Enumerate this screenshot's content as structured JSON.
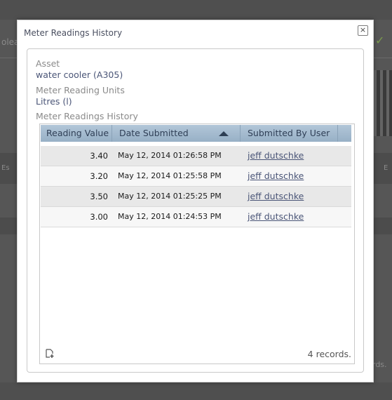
{
  "background": {
    "partial_texts": [
      "olea",
      "Es",
      "E",
      "rds."
    ]
  },
  "modal": {
    "title": "Meter Readings History",
    "close_glyph": "×",
    "asset_label": "Asset",
    "asset_value": "water cooler (A305)",
    "units_label": "Meter Reading Units",
    "units_value": "Litres (l)",
    "history_label": "Meter Readings History"
  },
  "grid": {
    "columns": [
      {
        "label": "Reading Value"
      },
      {
        "label": "Date Submitted",
        "sort": "ascending"
      },
      {
        "label": "Submitted By User"
      }
    ],
    "rows": [
      {
        "value": "3.40",
        "date": "May 12, 2014 01:26:58 PM",
        "user": "jeff dutschke"
      },
      {
        "value": "3.20",
        "date": "May 12, 2014 01:25:58 PM",
        "user": "jeff dutschke"
      },
      {
        "value": "3.50",
        "date": "May 12, 2014 01:25:25 PM",
        "user": "jeff dutschke"
      },
      {
        "value": "3.00",
        "date": "May 12, 2014 01:24:53 PM",
        "user": "jeff dutschke"
      }
    ],
    "footer": {
      "record_count": "4 records.",
      "add_icon": "add-record-icon"
    }
  },
  "colors": {
    "header_bg": "#a7bdd1",
    "link": "#4a5577",
    "overlay": "#565656"
  }
}
